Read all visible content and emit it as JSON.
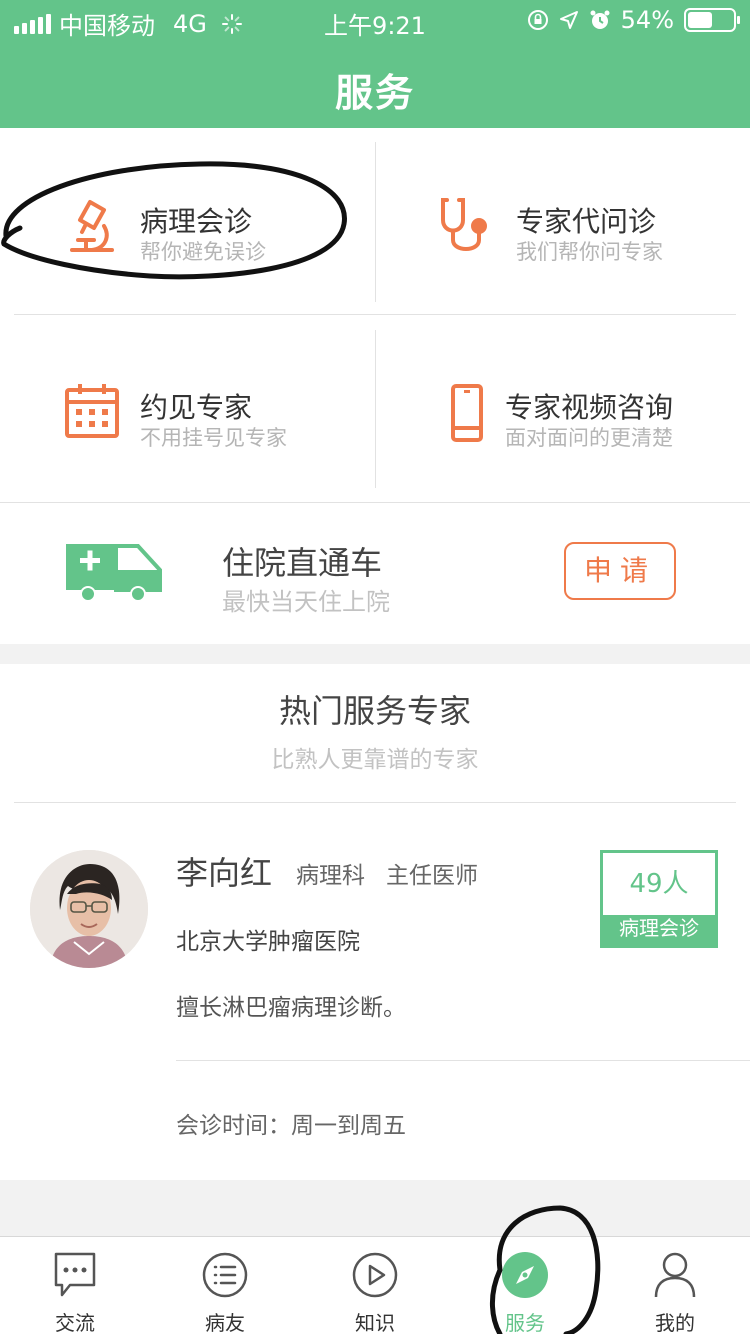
{
  "status_bar": {
    "carrier": "中国移动",
    "network": "4G",
    "time": "上午9:21",
    "battery": "54%",
    "battery_level": 0.54
  },
  "header": {
    "title": "服务"
  },
  "services": [
    {
      "title": "病理会诊",
      "subtitle": "帮你避免误诊",
      "icon": "microscope-icon"
    },
    {
      "title": "专家代问诊",
      "subtitle": "我们帮你问专家",
      "icon": "stethoscope-icon"
    },
    {
      "title": "约见专家",
      "subtitle": "不用挂号见专家",
      "icon": "calendar-icon"
    },
    {
      "title": "专家视频咨询",
      "subtitle": "面对面问的更清楚",
      "icon": "phone-icon"
    }
  ],
  "hospital_express": {
    "title": "住院直通车",
    "subtitle": "最快当天住上院",
    "button": "申请",
    "icon": "ambulance-icon"
  },
  "hot_experts": {
    "title": "热门服务专家",
    "subtitle": "比熟人更靠谱的专家",
    "experts": [
      {
        "name": "李向红",
        "department": "病理科",
        "title": "主任医师",
        "hospital": "北京大学肿瘤医院",
        "specialty": "擅长淋巴瘤病理诊断。",
        "schedule": "会诊时间：周一到周五",
        "count": "49人",
        "service": "病理会诊"
      }
    ]
  },
  "tabbar": [
    {
      "label": "交流",
      "icon": "chat-icon"
    },
    {
      "label": "病友",
      "icon": "list-icon"
    },
    {
      "label": "知识",
      "icon": "play-icon"
    },
    {
      "label": "服务",
      "icon": "compass-icon",
      "active": true
    },
    {
      "label": "我的",
      "icon": "user-icon"
    }
  ],
  "colors": {
    "brand_green": "#63c48a",
    "accent_orange": "#ef7a4a"
  }
}
